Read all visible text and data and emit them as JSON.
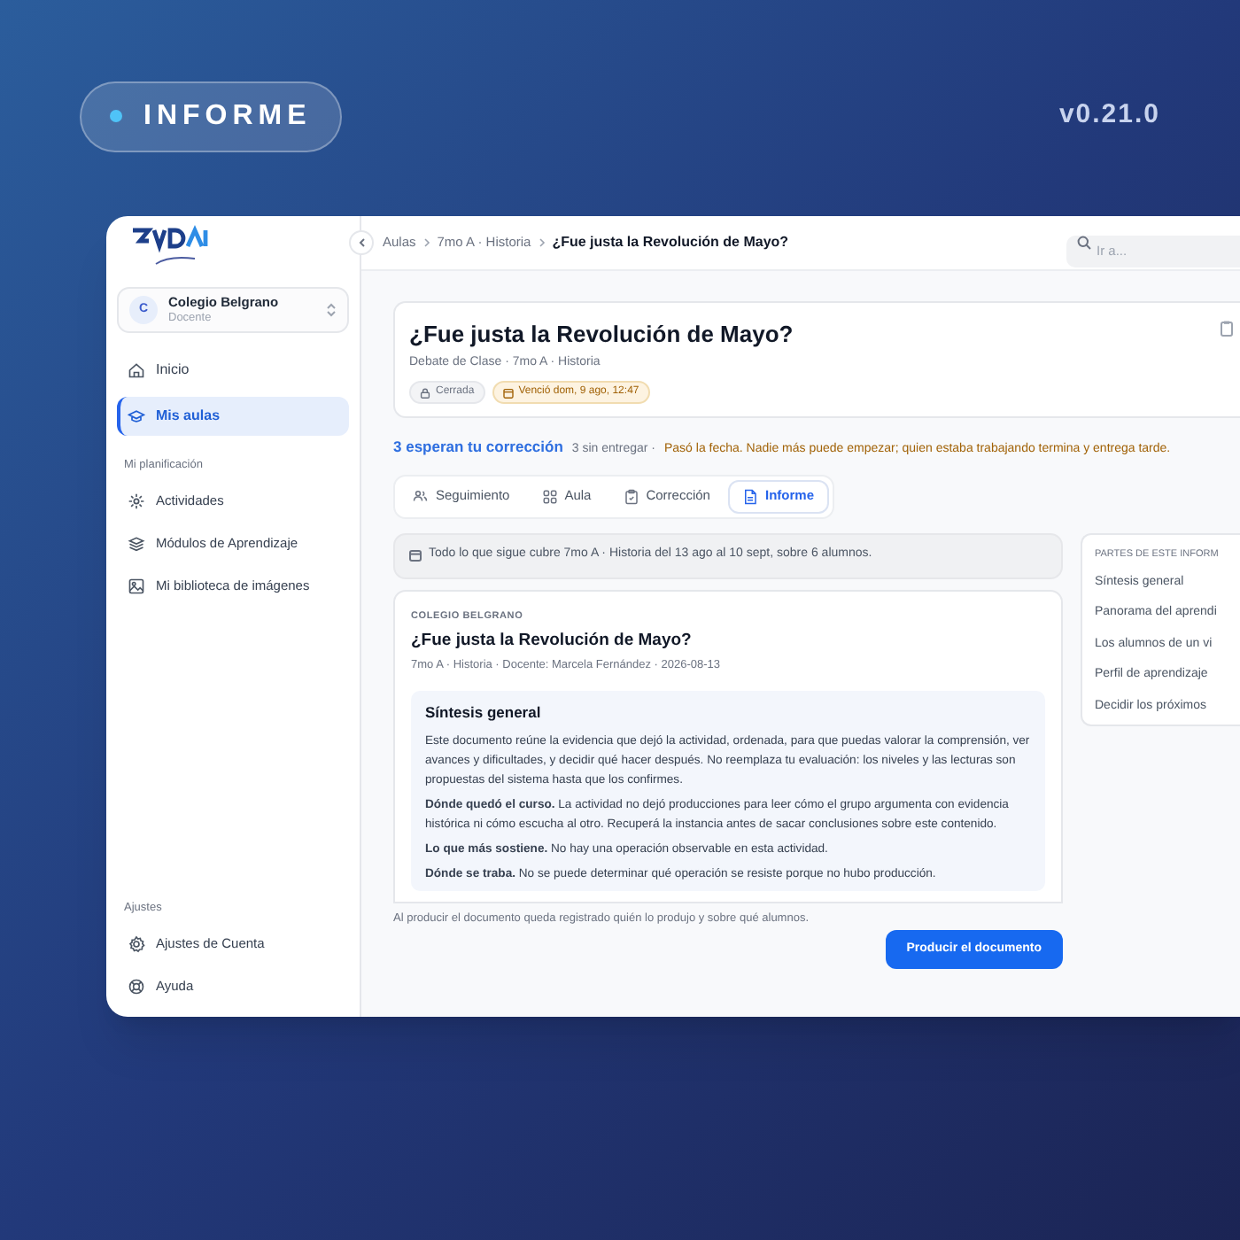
{
  "badge": {
    "label": "INFORME"
  },
  "version": "v0.21.0",
  "sidebar": {
    "school": {
      "initial": "C",
      "name": "Colegio Belgrano",
      "role": "Docente"
    },
    "items": [
      {
        "label": "Inicio",
        "selected": false
      },
      {
        "label": "Mis aulas",
        "selected": true
      }
    ],
    "planning": {
      "heading": "Mi planificación",
      "items": [
        {
          "label": "Actividades",
          "selected": false
        },
        {
          "label": "Módulos de Aprendizaje",
          "selected": false
        },
        {
          "label": "Mi biblioteca de imágenes",
          "selected": false
        }
      ]
    },
    "settings": {
      "heading": "Ajustes",
      "items": [
        {
          "label": "Ajustes de Cuenta",
          "selected": false
        },
        {
          "label": "Ayuda",
          "selected": false
        }
      ]
    }
  },
  "breadcrumb": [
    "Aulas",
    "7mo A · Historia",
    "¿Fue justa la Revolución de Mayo?"
  ],
  "search": {
    "placeholder": "Ir a..."
  },
  "activity": {
    "title": "¿Fue justa la Revolución de Mayo?",
    "subtitle": "Debate de Clase · 7mo A · Historia",
    "chips": [
      {
        "kind": "status",
        "label": "Cerrada"
      },
      {
        "kind": "deadline",
        "label": "Venció dom, 9 ago, 12:47"
      }
    ]
  },
  "summary": {
    "link": "3 esperan tu corrección",
    "pending": "3 sin entregar ·",
    "warning": "Pasó la fecha. Nadie más puede empezar; quien estaba trabajando termina y entrega tarde."
  },
  "tabs": [
    {
      "label": "Seguimiento",
      "selected": false
    },
    {
      "label": "Aula",
      "selected": false
    },
    {
      "label": "Corrección",
      "selected": false
    },
    {
      "label": "Informe",
      "selected": true
    }
  ],
  "scope_note": "Todo lo que sigue cubre 7mo A · Historia del 13 ago al 10 sept, sobre 6 alumnos.",
  "document": {
    "school": "COLEGIO BELGRANO",
    "title": "¿Fue justa la Revolución de Mayo?",
    "meta": "7mo A · Historia · Docente: Marcela Fernández · 2026-08-13",
    "section": {
      "heading": "Síntesis general",
      "paragraphs": [
        "Este documento reúne la evidencia que dejó la actividad, ordenada, para que puedas valorar la comprensión, ver avances y dificultades, y decidir qué hacer después. No reemplaza tu evaluación: los niveles y las lecturas son propuestas del sistema hasta que los confirmes.",
        "**Dónde quedó el curso.** La actividad no dejó producciones para leer cómo el grupo argumenta con evidencia histórica ni cómo escucha al otro. Recuperá la instancia antes de sacar conclusiones sobre este contenido.",
        "**Lo que más sostiene.** No hay una operación observable en esta actividad.",
        "**Dónde se traba.** No se puede determinar qué operación se resiste porque no hubo producción."
      ]
    }
  },
  "footer_note": "Al producir el documento queda registrado quién lo produjo y sobre qué alumnos.",
  "primary_button": "Producir el documento",
  "toc": {
    "heading": "PARTES DE ESTE INFORM",
    "items": [
      "Síntesis general",
      "Panorama del aprendi",
      "Los alumnos de un vi",
      "Perfil de aprendizaje",
      "Decidir los próximos"
    ]
  }
}
